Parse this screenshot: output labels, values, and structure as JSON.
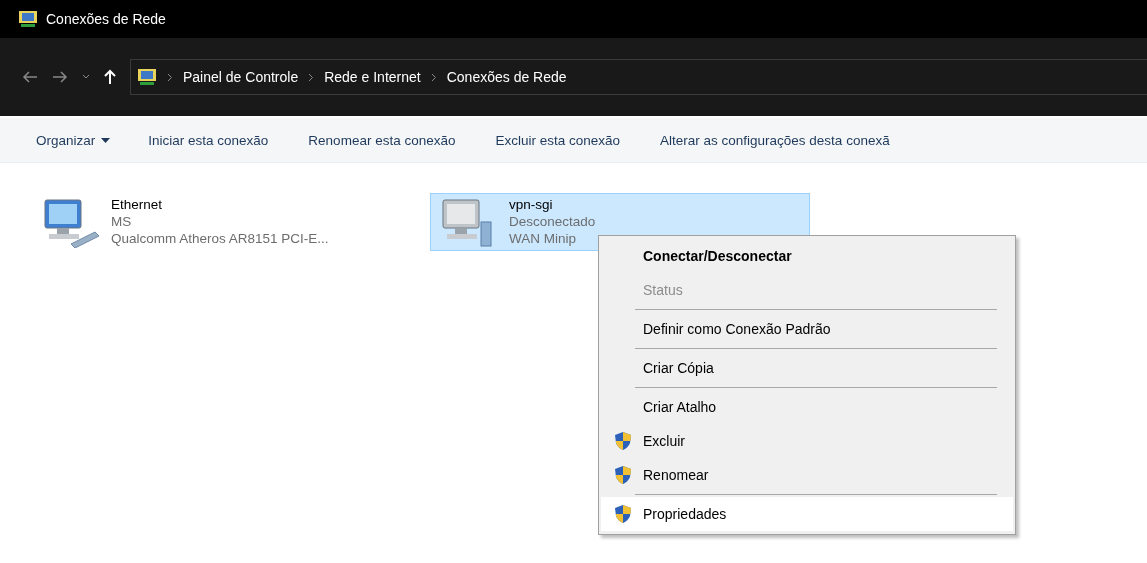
{
  "window": {
    "title": "Conexões de Rede"
  },
  "breadcrumb": [
    "Painel de Controle",
    "Rede e Internet",
    "Conexões de Rede"
  ],
  "toolbar": [
    {
      "label": "Organizar",
      "dropdown": true
    },
    {
      "label": "Iniciar esta conexão",
      "dropdown": false
    },
    {
      "label": "Renomear esta conexão",
      "dropdown": false
    },
    {
      "label": "Excluir esta conexão",
      "dropdown": false
    },
    {
      "label": "Alterar as configurações desta conexã",
      "dropdown": false
    }
  ],
  "connections": [
    {
      "name": "Ethernet",
      "status": "MS",
      "device": "Qualcomm Atheros AR8151 PCI-E...",
      "kind": "ethernet",
      "selected": false
    },
    {
      "name": "vpn-sgi",
      "status": "Desconectado",
      "device": "WAN Minip",
      "kind": "vpn",
      "selected": true
    }
  ],
  "context_menu": {
    "groups": [
      [
        {
          "label": "Conectar/Desconectar",
          "default": true,
          "disabled": false,
          "shield": false,
          "selected": false
        },
        {
          "label": "Status",
          "default": false,
          "disabled": true,
          "shield": false,
          "selected": false
        }
      ],
      [
        {
          "label": "Definir como Conexão Padrão",
          "default": false,
          "disabled": false,
          "shield": false,
          "selected": false
        }
      ],
      [
        {
          "label": "Criar Cópia",
          "default": false,
          "disabled": false,
          "shield": false,
          "selected": false
        }
      ],
      [
        {
          "label": "Criar Atalho",
          "default": false,
          "disabled": false,
          "shield": false,
          "selected": false
        },
        {
          "label": "Excluir",
          "default": false,
          "disabled": false,
          "shield": true,
          "selected": false
        },
        {
          "label": "Renomear",
          "default": false,
          "disabled": false,
          "shield": true,
          "selected": false
        }
      ],
      [
        {
          "label": "Propriedades",
          "default": false,
          "disabled": false,
          "shield": true,
          "selected": true
        }
      ]
    ]
  }
}
